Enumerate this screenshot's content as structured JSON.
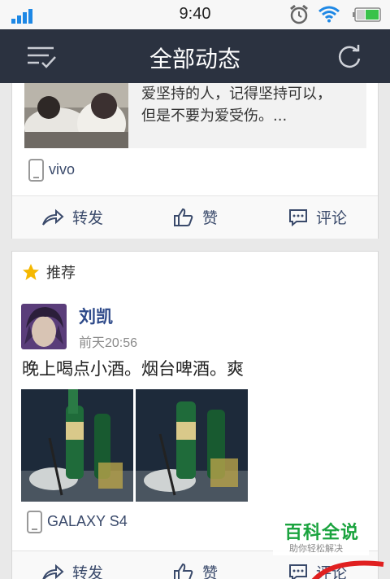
{
  "status_bar": {
    "time": "9:40"
  },
  "header": {
    "title": "全部动态"
  },
  "post1": {
    "shared_text": [
      "爱坚持的人，记得坚持可以，",
      "但是不要为爱受伤。..."
    ],
    "device": "vivo",
    "actions": {
      "forward": "转发",
      "like": "赞",
      "comment": "评论"
    }
  },
  "post2": {
    "recommend_label": "推荐",
    "username": "刘凯",
    "time": "前天20:56",
    "text": "晚上喝点小酒。烟台啤酒。爽",
    "device": "GALAXY S4",
    "actions": {
      "forward": "转发",
      "like": "赞",
      "comment": "评论"
    }
  },
  "watermark": {
    "main": "百科全说",
    "sub": "助你轻松解决"
  },
  "colors": {
    "header_bg": "#2b3240",
    "link": "#3a4a6b",
    "username": "#2e4a8a",
    "watermark": "#1aa33e"
  }
}
